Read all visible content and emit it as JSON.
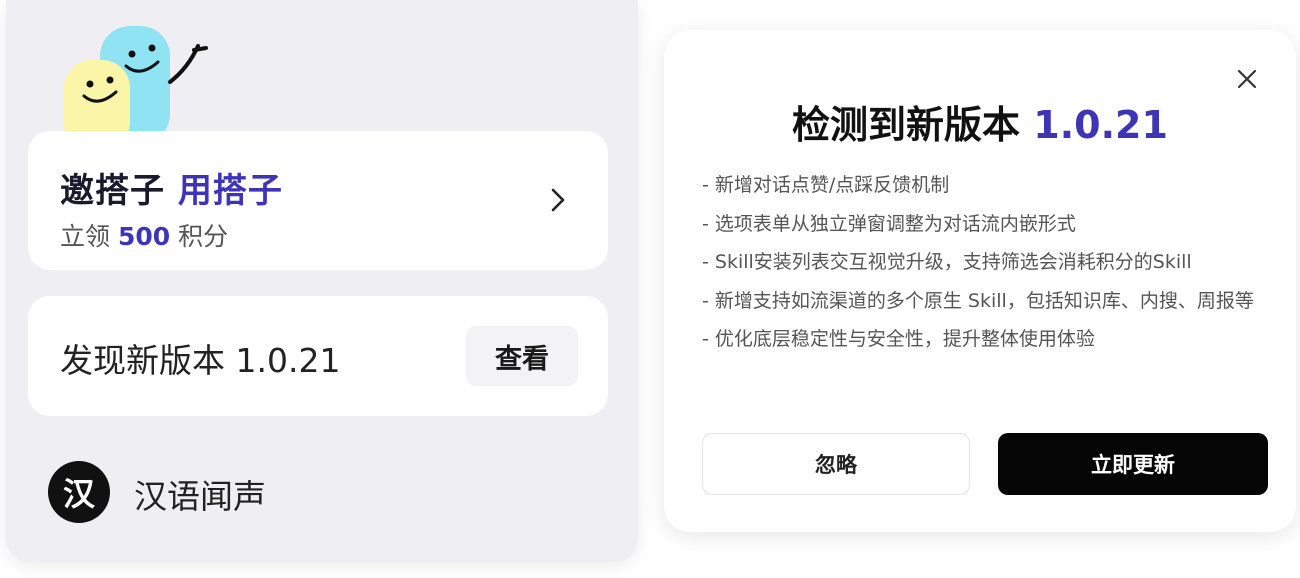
{
  "invite": {
    "title_part1": "邀搭子",
    "title_part2": "用搭子",
    "subtitle_prefix": "立领",
    "subtitle_number": "500",
    "subtitle_suffix": "积分"
  },
  "version_card": {
    "text": "发现新版本 1.0.21",
    "view_label": "查看"
  },
  "han_item": {
    "icon_char": "汉",
    "label": "汉语闻声"
  },
  "dialog": {
    "title": "检测到新版本",
    "version": "1.0.21",
    "notes": [
      "- 新增对话点赞/点踩反馈机制",
      "- 选项表单从独立弹窗调整为对话流内嵌形式",
      "- Skill安装列表交互视觉升级，支持筛选会消耗积分的Skill",
      "- 新增支持如流渠道的多个原生 Skill，包括知识库、内搜、周报等",
      "- 优化底层稳定性与安全性，提升整体使用体验"
    ],
    "ignore_label": "忽略",
    "update_label": "立即更新"
  },
  "colors": {
    "accent": "#3d34b8",
    "panel_bg": "#efeff3",
    "primary_button": "#050505"
  },
  "icons": {
    "mascot": "mascot-illustration",
    "chevron": "chevron-right-icon",
    "close": "close-icon"
  }
}
